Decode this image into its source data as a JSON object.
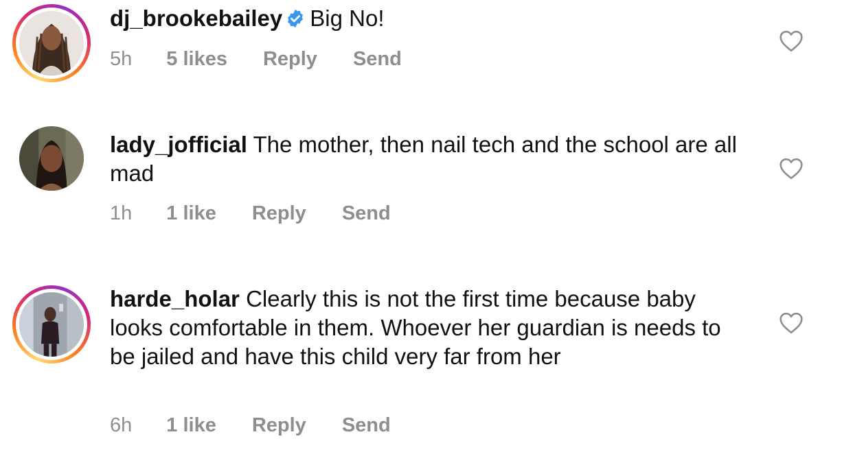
{
  "comments": [
    {
      "username": "dj_brookebailey",
      "verified": true,
      "text": "Big No!",
      "time": "5h",
      "likes": "5 likes",
      "reply": "Reply",
      "send": "Send"
    },
    {
      "username": "lady_jofficial",
      "verified": false,
      "text": "The mother, then nail tech and the school are all mad",
      "time": "1h",
      "likes": "1 like",
      "reply": "Reply",
      "send": "Send"
    },
    {
      "username": "harde_holar",
      "verified": false,
      "text": "Clearly this is not the first time because baby looks comfortable in them. Whoever her guardian is needs to be jailed and have this child very far from her",
      "time": "6h",
      "likes": "1 like",
      "reply": "Reply",
      "send": "Send"
    }
  ],
  "colors": {
    "text": "#111111",
    "meta": "#8e8e8e",
    "verified": "#3897f0",
    "story_ring": [
      "#feda75",
      "#fa7e1e",
      "#d62976",
      "#962fbf"
    ]
  },
  "icons": {
    "like": "heart-outline-icon",
    "verified": "verified-badge-icon"
  }
}
